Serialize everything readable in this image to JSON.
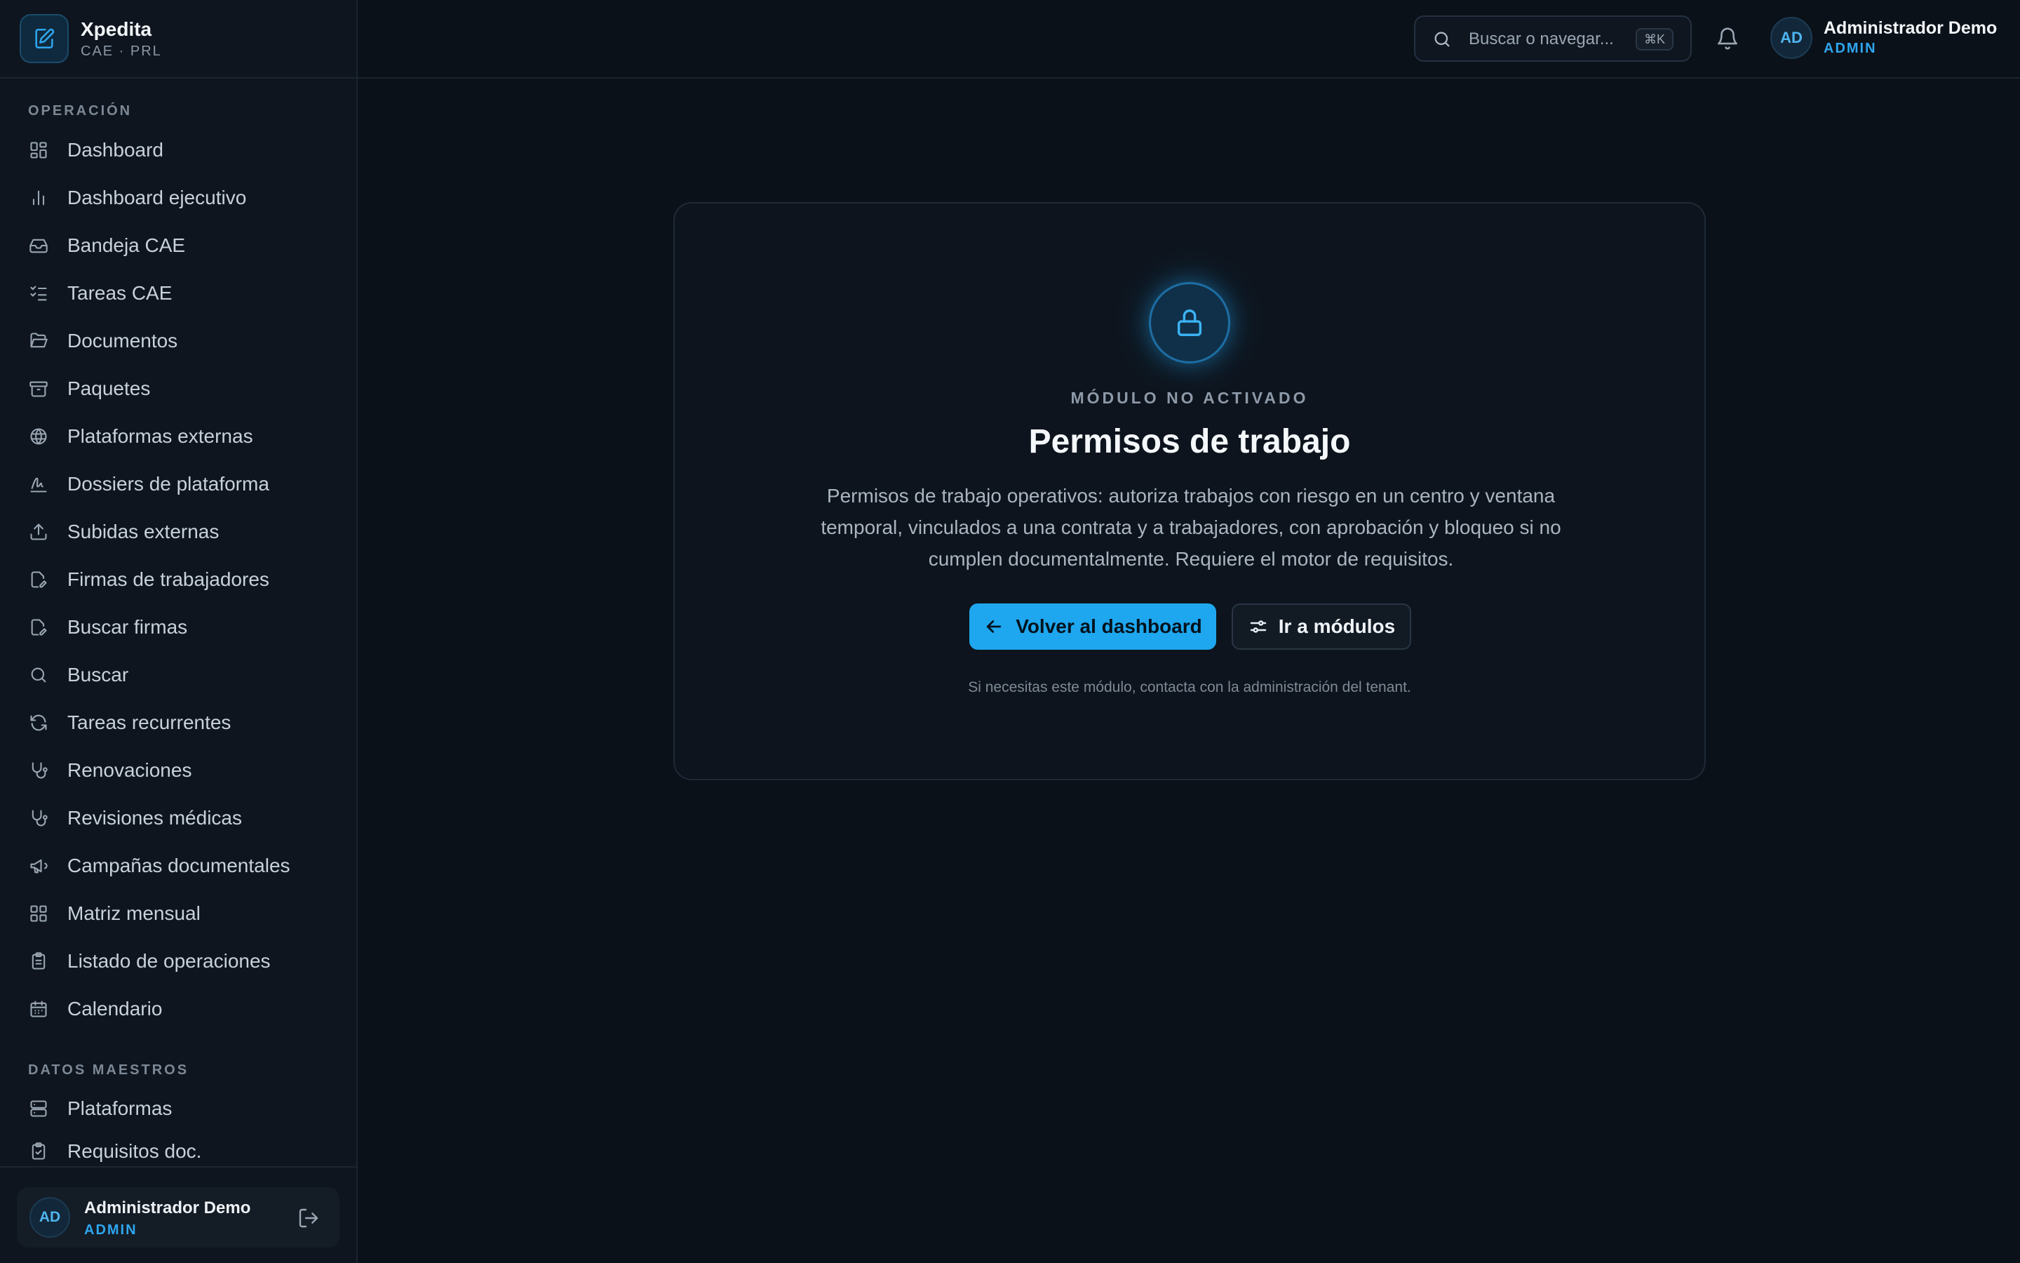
{
  "brand": {
    "name": "Xpedita",
    "subtitle": "CAE · PRL",
    "icon": "edit-document-icon"
  },
  "sidebar": {
    "sections": [
      {
        "title": "OPERACIÓN"
      },
      {
        "title": "DATOS MAESTROS"
      }
    ],
    "items": [
      {
        "label": "Dashboard",
        "icon": "dashboard-icon"
      },
      {
        "label": "Dashboard ejecutivo",
        "icon": "bar-chart-icon"
      },
      {
        "label": "Bandeja CAE",
        "icon": "inbox-icon"
      },
      {
        "label": "Tareas CAE",
        "icon": "checklist-icon"
      },
      {
        "label": "Documentos",
        "icon": "folder-open-icon"
      },
      {
        "label": "Paquetes",
        "icon": "archive-icon"
      },
      {
        "label": "Plataformas externas",
        "icon": "globe-icon"
      },
      {
        "label": "Dossiers de plataforma",
        "icon": "signature-icon"
      },
      {
        "label": "Subidas externas",
        "icon": "upload-icon"
      },
      {
        "label": "Firmas de trabajadores",
        "icon": "file-pen-icon"
      },
      {
        "label": "Buscar firmas",
        "icon": "file-pen-icon"
      },
      {
        "label": "Buscar",
        "icon": "search-icon"
      },
      {
        "label": "Tareas recurrentes",
        "icon": "refresh-icon"
      },
      {
        "label": "Renovaciones",
        "icon": "stethoscope-icon"
      },
      {
        "label": "Revisiones médicas",
        "icon": "stethoscope-icon"
      },
      {
        "label": "Campañas documentales",
        "icon": "megaphone-icon"
      },
      {
        "label": "Matriz mensual",
        "icon": "grid-icon"
      },
      {
        "label": "Listado de operaciones",
        "icon": "clipboard-list-icon"
      },
      {
        "label": "Calendario",
        "icon": "calendar-icon"
      },
      {
        "label": "Plataformas",
        "icon": "server-icon"
      },
      {
        "label": "Requisitos doc.",
        "icon": "clipboard-check-icon"
      }
    ]
  },
  "topbar": {
    "search_placeholder": "Buscar o navegar...",
    "shortcut": "⌘K",
    "user": {
      "initials": "AD",
      "name": "Administrador Demo",
      "role": "ADMIN"
    }
  },
  "footer_user": {
    "initials": "AD",
    "name": "Administrador Demo",
    "role": "ADMIN"
  },
  "main": {
    "eyebrow": "MÓDULO NO ACTIVADO",
    "title": "Permisos de trabajo",
    "description": "Permisos de trabajo operativos: autoriza trabajos con riesgo en un centro y ventana temporal, vinculados a una contrata y a trabajadores, con aprobación y bloqueo si no cumplen documentalmente. Requiere el motor de requisitos.",
    "primary_button": "Volver al dashboard",
    "secondary_button": "Ir a módulos",
    "note": "Si necesitas este módulo, contacta con la administración del tenant."
  },
  "colors": {
    "accent": "#1ea7ef",
    "background": "#0b1119",
    "sidebar": "#0e151e"
  }
}
